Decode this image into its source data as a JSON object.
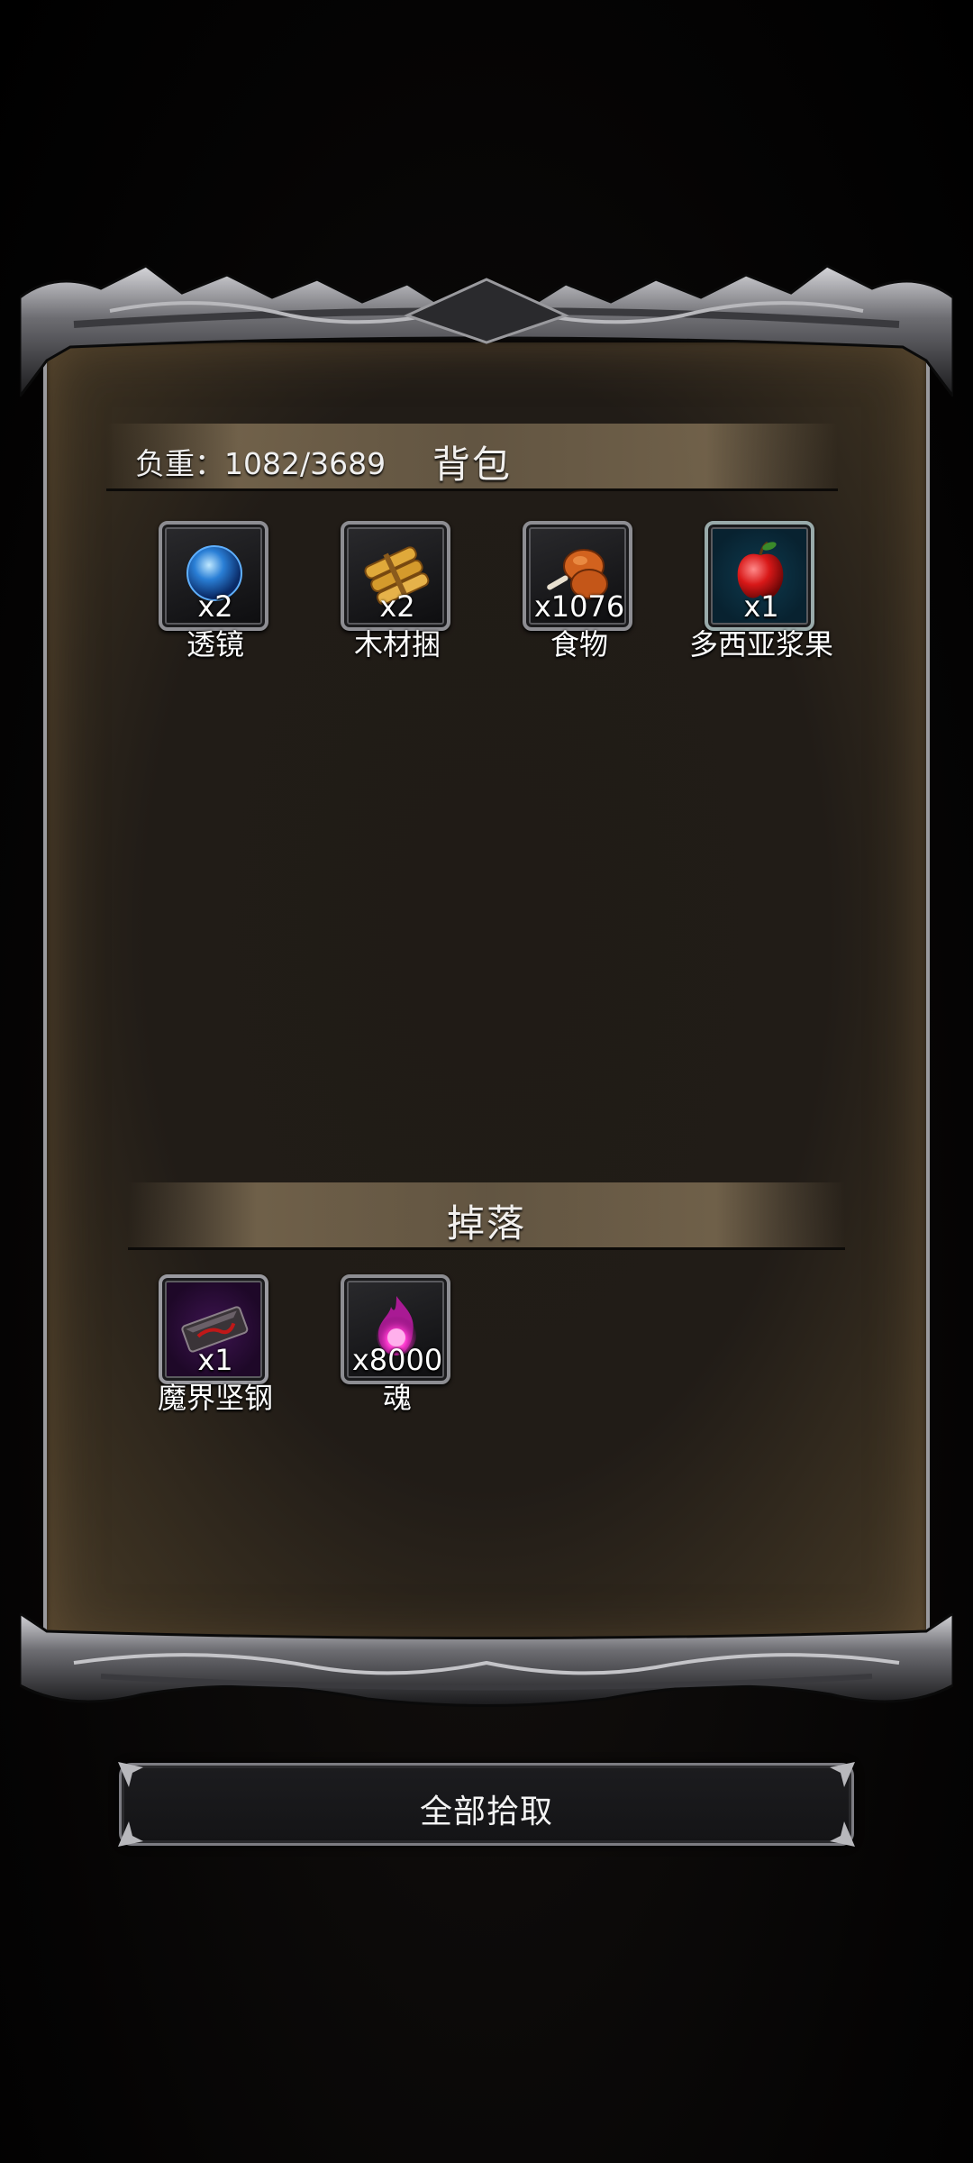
{
  "inventory": {
    "title": "背包",
    "weight_label": "负重：1082/3689",
    "items": [
      {
        "qty": "x2",
        "name": "透镜",
        "icon": "blue-orb-icon"
      },
      {
        "qty": "x2",
        "name": "木材捆",
        "icon": "wood-bundle-icon"
      },
      {
        "qty": "x1076",
        "name": "食物",
        "icon": "meat-leg-icon"
      },
      {
        "qty": "x1",
        "name": "多西亚浆果",
        "icon": "red-berry-icon"
      }
    ]
  },
  "drops": {
    "title": "掉落",
    "items": [
      {
        "qty": "x1",
        "name": "魔界坚钢",
        "icon": "dark-steel-ingot-icon"
      },
      {
        "qty": "x8000",
        "name": "魂",
        "icon": "pink-soul-flame-icon"
      }
    ]
  },
  "actions": {
    "pickup_all": "全部拾取"
  },
  "colors": {
    "panel": "#211c17",
    "frame": "#8d8d92",
    "header_band": "#7d6c52",
    "button_bg": "#18181b"
  }
}
